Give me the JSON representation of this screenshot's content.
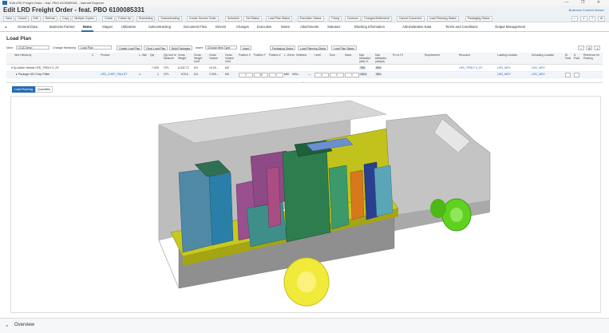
{
  "window": {
    "title": "Edit LRD Freight Order - feat. PBO 6100085331 - Internet Explorer",
    "controls": "— ❐ ✕"
  },
  "header": {
    "title": "Edit LRD Freight Order - feat. PBO 6100085331",
    "business_context": "Business Context Viewer"
  },
  "toolbar": {
    "items": [
      "Save",
      "Cancel",
      "Edit",
      "Refresh",
      "Copy",
      "Multiple Copies",
      "Check",
      "Follow Up",
      "Scheduling",
      "Subcontracting",
      "Create Service Order",
      "Schedule",
      "Set Status",
      "Load Plan Status",
      "Execution Status",
      "Fixing",
      "Customs",
      "Charges/Settlement",
      "Cancel Document",
      "Load Planning Status",
      "Packaging Status"
    ]
  },
  "tabs": {
    "items": [
      "General Data",
      "Business Partner",
      "Items",
      "Stages",
      "Utilization",
      "Subcontracting",
      "Document Flow",
      "Drivers",
      "Charges",
      "Execution",
      "Notes",
      "Attachments",
      "Statuses",
      "Blocking Information",
      "Administrative Data",
      "Terms and Conditions",
      "Output Management"
    ],
    "selected": "Items"
  },
  "load_plan": {
    "title": "Load Plan",
    "view_label": "View:",
    "view_value": "CCA Demo",
    "change_label": "Change Hierarchy:",
    "change_value": "Load Plan",
    "btn_create": "Create Load Plan",
    "btn_clear": "Clear Load Plan",
    "btn_build": "Build Packages",
    "insert_label": "Insert",
    "insert_value": "Choose Item Type",
    "btn_insert": "Insert",
    "btn_packaging_status": "Packaging Status",
    "btn_load_planning_status": "Load Planning Status",
    "btn_load_plan_status": "Load Plan Status"
  },
  "columns": [
    "Item Hierarchy",
    "C",
    "Product",
    "L. Stat",
    "Qty",
    "Qty Unit of Measure",
    "Gross Weight",
    "Gross Weight UoM",
    "Gross Volume",
    "Gross Volume UoM",
    "Position X",
    "Position Y",
    "Position Z",
    "L. Orient",
    "Inherited",
    "Level",
    "Row",
    "Stack",
    "Max Utilization (abs) %",
    "Max Utilization (weight)",
    "PU or PJ",
    "Requirement",
    "Resource",
    "Loading Location",
    "Unloading Location",
    "M. Pack",
    "S. Pack",
    "Reference for Packing"
  ],
  "rows": [
    {
      "hierarchy": "▾ Sy Active Vehicle LRD_TRDLY 0_SY",
      "qty": "7,009",
      "uom": "CPL",
      "weight": "6,332.72",
      "weight_uom": "KG",
      "volume": "10.00...",
      "volume_uom": "M3",
      "util_abs": "75%",
      "util_wt": "59%",
      "resource": "LRD_TRDLY 0_SY",
      "loading": "LRD_WSY",
      "unloading": "LRD_WSY"
    },
    {
      "hierarchy": "▸ Package 000 Chep Pallet",
      "product": "LRD_CHEP_PALLET",
      "qty": "1",
      "uom": "CPL",
      "weight": "670.6",
      "weight_uom": "KG",
      "volume": "2.025...",
      "volume_uom": "M3",
      "pos_x": "0",
      "pos_y": "20",
      "pos_z": "0",
      "orient_unit": "MM",
      "orient": "000L...",
      "inherited": "—",
      "level": "0",
      "row": "0",
      "stack": "0",
      "util_abs": "100%",
      "util_wt": "36%",
      "loading": "LRD_WSY",
      "unloading": "LRD_WSY"
    }
  ],
  "subtabs": {
    "items": [
      "Load Planning",
      "Quantities"
    ],
    "selected": "Load Planning"
  },
  "overview": {
    "title": "Overview"
  },
  "colors": {
    "accent": "#2a6ab0",
    "truck_body": "#c9c9c9",
    "wheel_front": "#5fd21f",
    "wheel_rear": "#f2ea3a",
    "load_floor": "#c8c81e",
    "green_stack": "#2e7d4e",
    "purple_stack": "#9a4f8e",
    "teal_stack": "#4a9bb0",
    "orange_stack": "#d6781c",
    "blue_stack": "#2a3f8f"
  }
}
